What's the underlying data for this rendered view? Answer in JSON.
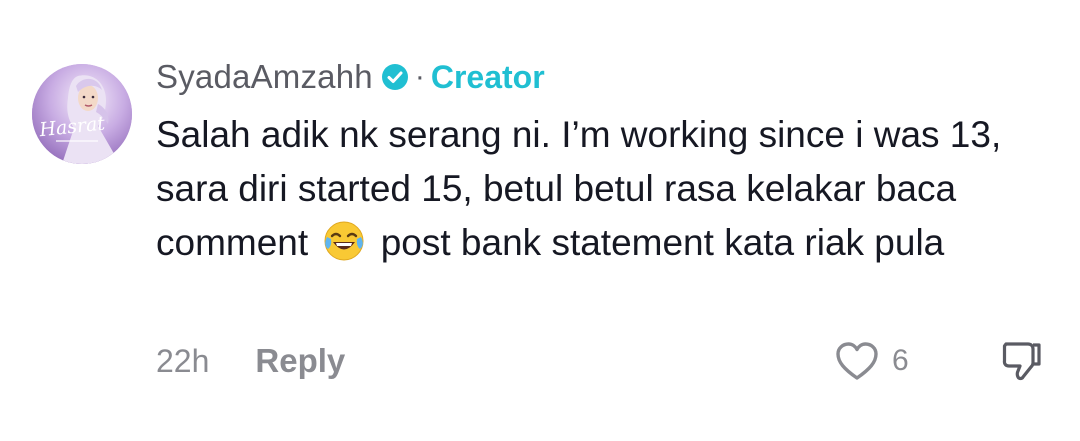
{
  "comment": {
    "username": "SyadaAmzahh",
    "badge_icon": "verified-icon",
    "separator": "·",
    "role_label": "Creator",
    "text_before_emoji": "Salah adik nk serang ni. I’m working since i was 13, sara diri started 15, betul betul rasa kelakar baca comment",
    "emoji_icon": "tears-of-joy-emoji",
    "text_after_emoji": "post bank statement kata riak pula",
    "time": "22h",
    "reply_label": "Reply",
    "like_count": "6",
    "like_icon": "heart-icon",
    "dislike_icon": "thumbs-down-icon",
    "avatar_text": "Hasrat"
  },
  "colors": {
    "creator_accent": "#20bfd2",
    "verified_badge": "#20bfd2",
    "muted_text": "#8a8b91",
    "primary_text": "#161823"
  }
}
